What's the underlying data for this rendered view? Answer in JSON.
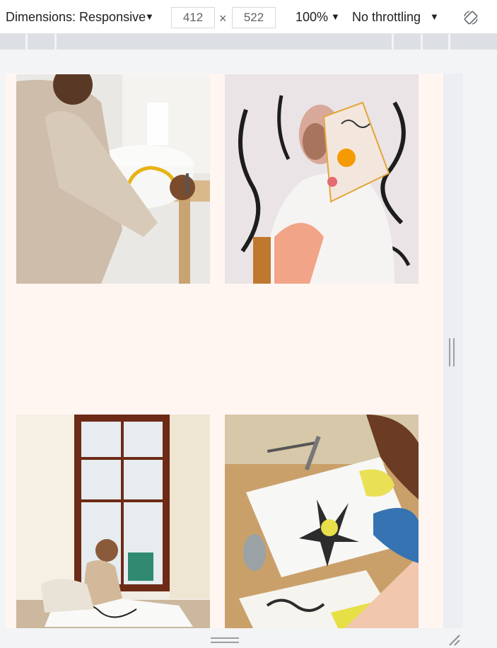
{
  "toolbar": {
    "dimensions_label": "Dimensions: Responsive",
    "width": "412",
    "height": "522",
    "times": "×",
    "zoom": "100%",
    "throttling": "No throttling",
    "caret": "▼"
  },
  "icons": {
    "dropdown": "caret-down-icon",
    "rotate": "rotate-device-icon",
    "resize_side": "resize-handle-icon",
    "resize_bottom": "resize-handle-icon",
    "resize_corner": "resize-corner-icon"
  },
  "colors": {
    "viewport_bg": "#fff6f2",
    "chrome_bg": "#f3f4f6"
  }
}
